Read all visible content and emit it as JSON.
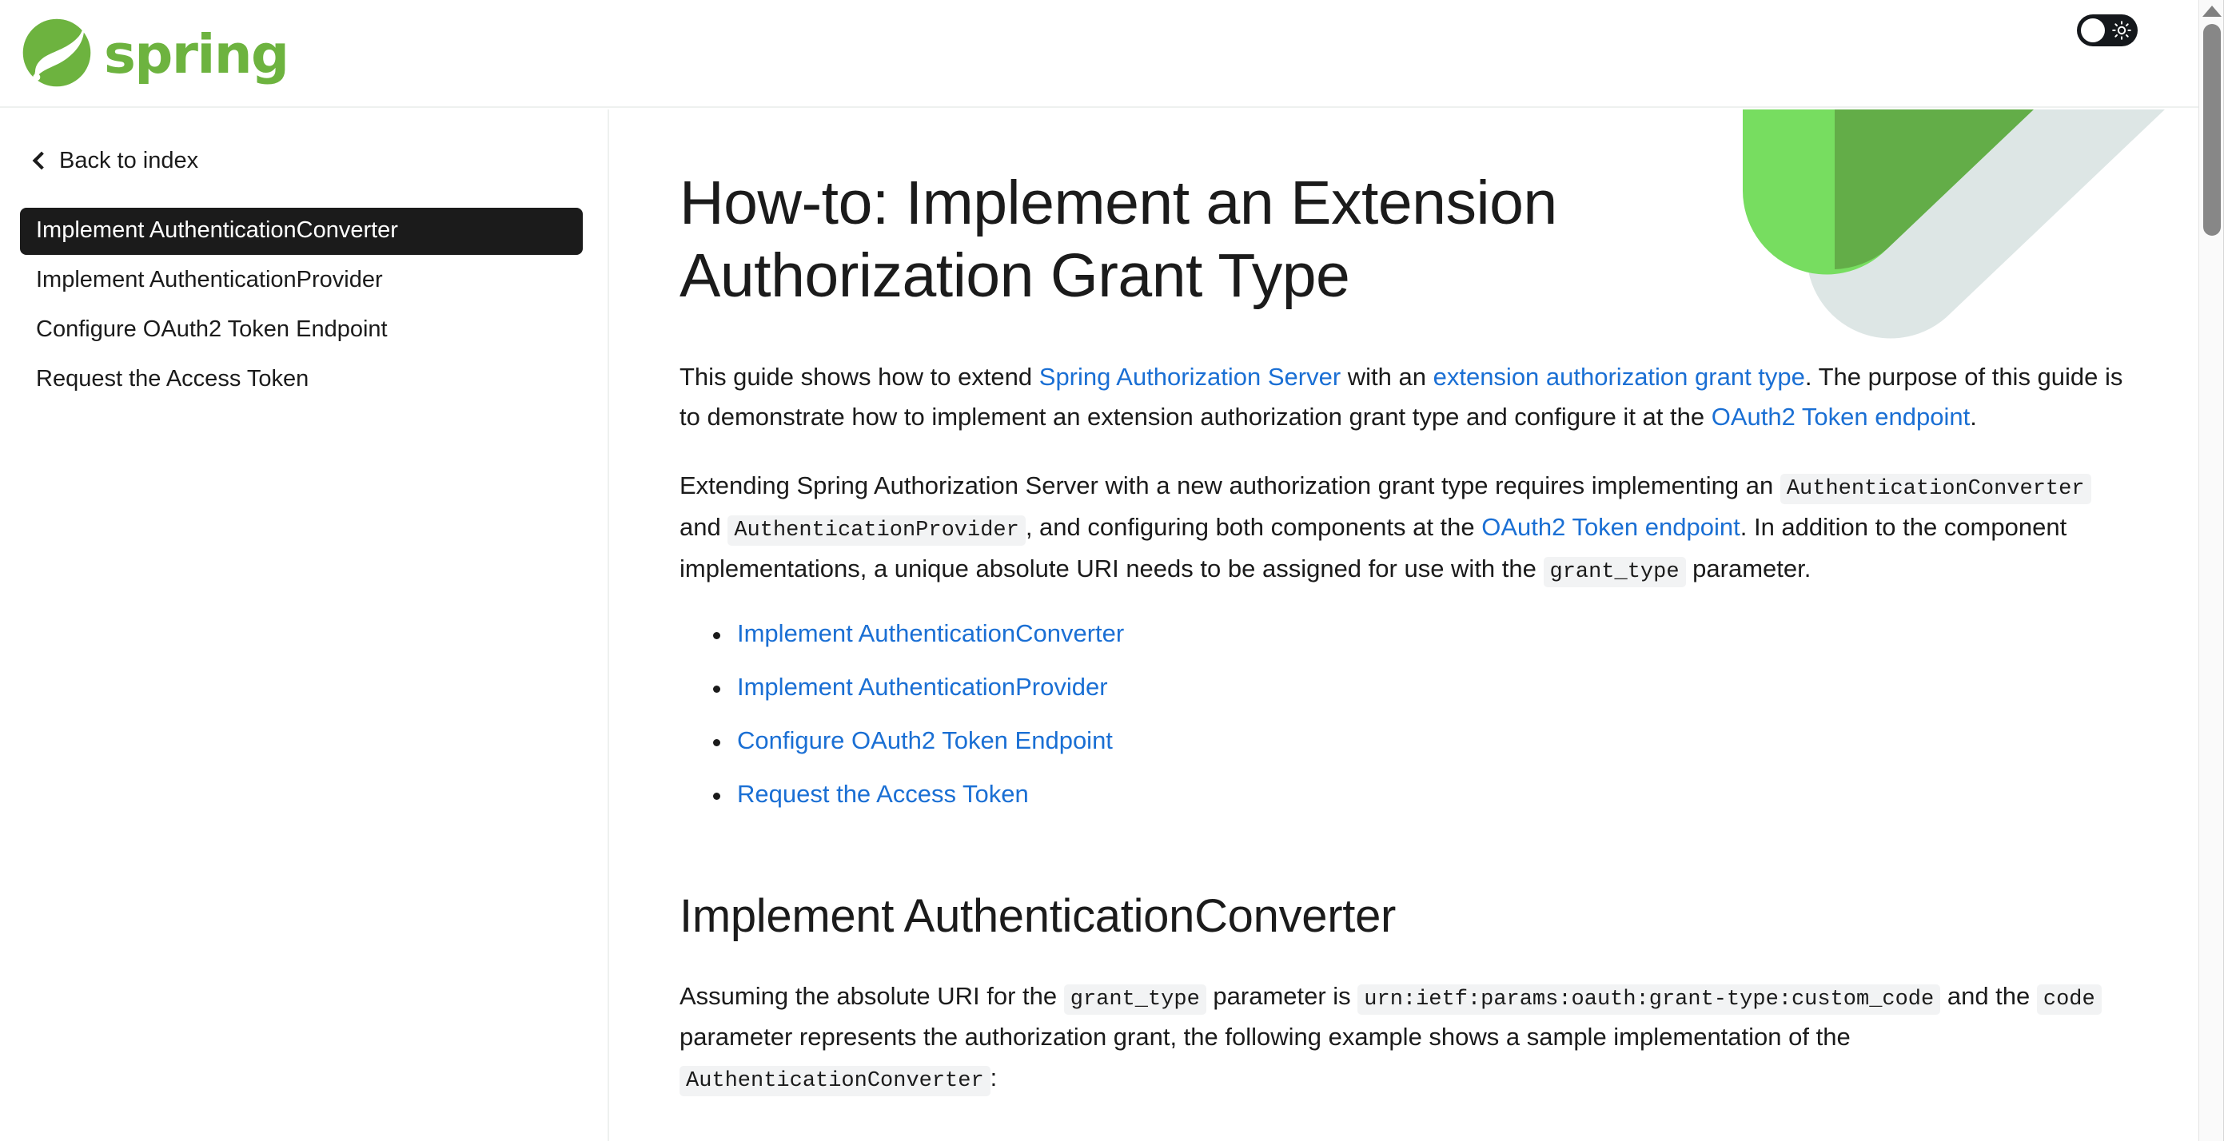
{
  "header": {
    "logo_word": "spring",
    "logo_icon": "spring-leaf-logo",
    "theme_toggle_icon": "sun-icon",
    "theme_toggle_label": "Toggle light mode"
  },
  "sidebar": {
    "back_label": "Back to index",
    "back_icon": "chevron-left-icon",
    "items": [
      {
        "label": "Implement AuthenticationConverter",
        "active": true
      },
      {
        "label": "Implement AuthenticationProvider",
        "active": false
      },
      {
        "label": "Configure OAuth2 Token Endpoint",
        "active": false
      },
      {
        "label": "Request the Access Token",
        "active": false
      }
    ]
  },
  "main": {
    "title": "How-to: Implement an Extension Authorization Grant Type",
    "intro": {
      "p1_a": "This guide shows how to extend ",
      "p1_link1": "Spring Authorization Server",
      "p1_b": " with an ",
      "p1_link2": "extension authorization grant type",
      "p1_c": ". The purpose of this guide is to demonstrate how to implement an extension authorization grant type and configure it at the ",
      "p1_link3": "OAuth2 Token endpoint",
      "p1_d": "."
    },
    "paragraph2": {
      "a": "Extending Spring Authorization Server with a new authorization grant type requires implementing an ",
      "code1": "AuthenticationConverter",
      "b": " and ",
      "code2": "AuthenticationProvider",
      "c": ", and configuring both components at the ",
      "link1": "OAuth2 Token endpoint",
      "d": ". In addition to the component implementations, a unique absolute URI needs to be assigned for use with the ",
      "code3": "grant_type",
      "e": " parameter."
    },
    "toc": [
      "Implement AuthenticationConverter",
      "Implement AuthenticationProvider",
      "Configure OAuth2 Token Endpoint",
      "Request the Access Token"
    ],
    "section1": {
      "heading": "Implement AuthenticationConverter",
      "p_a": "Assuming the absolute URI for the ",
      "p_code1": "grant_type",
      "p_b": " parameter is ",
      "p_code2": "urn:ietf:params:oauth:grant-type:custom_code",
      "p_c": " and the ",
      "p_code3": "code",
      "p_d": " parameter represents the authorization grant, the following example shows a sample implementation of the ",
      "p_code4": "AuthenticationConverter",
      "p_e": ":"
    }
  },
  "colors": {
    "brand_green": "#6db33f",
    "link_blue": "#1a6fd4",
    "active_nav_bg": "#1b1b1b",
    "inline_code_bg": "#f2f3f4",
    "swoosh_light_green": "#77dd60",
    "swoosh_green": "#63ad48",
    "swoosh_pale": "#dde6e5"
  },
  "scrollbar": {
    "up_arrow_icon": "triangle-up-icon"
  }
}
